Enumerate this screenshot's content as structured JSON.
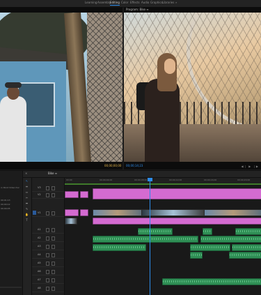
{
  "workspaces": [
    "Learning",
    "Assembly",
    "Editing",
    "Color",
    "Effects",
    "Audio",
    "Graphics",
    "Libraries"
  ],
  "active_workspace_index": 2,
  "source_monitor": {
    "title": "",
    "timecode": "00;00;00;00",
    "controls": "◀ ▶ ⬛"
  },
  "program_monitor": {
    "title": "Program: Bike ≡",
    "timecode": "00;00;14;23",
    "controls": "◀❘ ▶ ❘▶"
  },
  "timeline": {
    "tabs": [
      "✕",
      "Bike ≡"
    ],
    "ruler_labels": [
      "00;00",
      "00;00;04;00",
      "00;00;08;00",
      "00;00;12;00",
      "00;00;16;00",
      "00;00;20;00"
    ],
    "tracks": [
      {
        "label": "V3"
      },
      {
        "label": "V2"
      },
      {
        "label": "V1"
      },
      {
        "label": "A1"
      },
      {
        "label": "A2"
      },
      {
        "label": "A3"
      },
      {
        "label": "A4"
      },
      {
        "label": "A5"
      },
      {
        "label": "A6"
      },
      {
        "label": "A7"
      },
      {
        "label": "A8"
      },
      {
        "label": "Master"
      }
    ]
  },
  "project_panel": {
    "rows": [
      "Bike",
      "in Point  Video Dur",
      "00;01;13",
      "00;00;12",
      "00;00;05"
    ]
  },
  "tools": [
    "↖",
    "⇹",
    "⇔",
    "✂",
    "⬌",
    "✎",
    "✋",
    "T"
  ],
  "colors": {
    "accent": "#2d8ceb",
    "video_clip": "#d46bd1",
    "audio_clip": "#2f8e55",
    "timecode_source": "#e4b54a"
  }
}
